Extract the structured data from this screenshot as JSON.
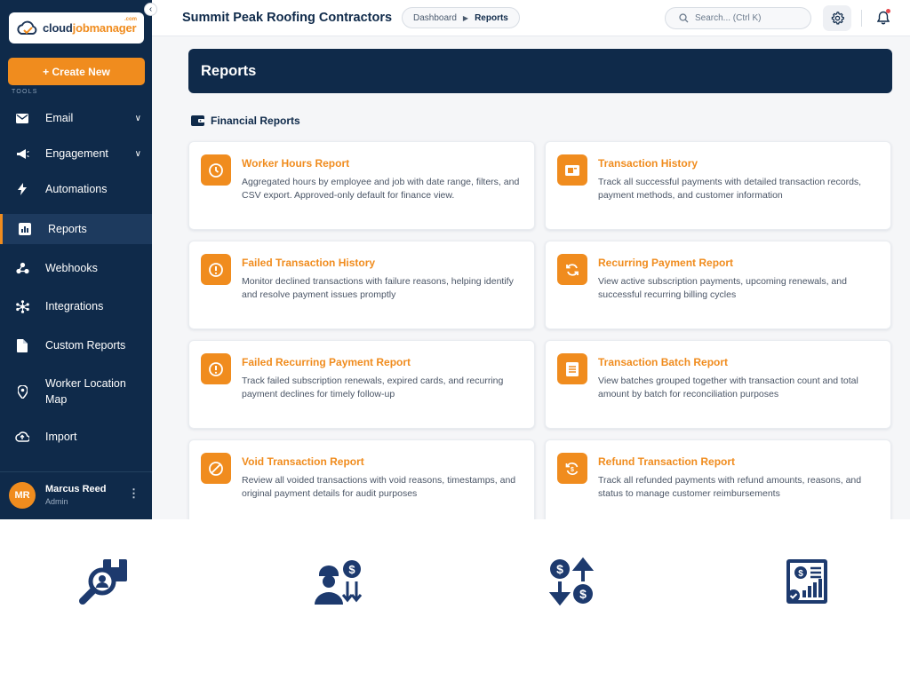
{
  "brand": {
    "name_part1": "cloud",
    "name_part2": "jobmanager",
    "suffix": ".com"
  },
  "sidebar": {
    "create_label": "+ Create New",
    "section_label": "TOOLS",
    "items": [
      {
        "label": "Email",
        "icon": "mail-icon",
        "has_chevron": true
      },
      {
        "label": "Engagement",
        "icon": "megaphone-icon",
        "has_chevron": true
      },
      {
        "label": "Automations",
        "icon": "bolt-icon",
        "has_chevron": false
      },
      {
        "label": "Reports",
        "icon": "chart-icon",
        "has_chevron": false,
        "active": true
      },
      {
        "label": "Webhooks",
        "icon": "webhook-icon",
        "has_chevron": false
      },
      {
        "label": "Integrations",
        "icon": "integrations-icon",
        "has_chevron": false
      },
      {
        "label": "Custom Reports",
        "icon": "file-icon",
        "has_chevron": false
      },
      {
        "label": "Worker Location Map",
        "icon": "location-pin-icon",
        "has_chevron": false
      },
      {
        "label": "Import",
        "icon": "cloud-upload-icon",
        "has_chevron": false
      }
    ],
    "user": {
      "initials": "MR",
      "name": "Marcus Reed",
      "role": "Admin"
    }
  },
  "topbar": {
    "company": "Summit Peak Roofing Contractors",
    "breadcrumb": [
      "Dashboard",
      "Reports"
    ],
    "search_placeholder": "Search... (Ctrl K)"
  },
  "page": {
    "title": "Reports",
    "section_title": "Financial Reports"
  },
  "reports": [
    {
      "title": "Worker Hours Report",
      "description": "Aggregated hours by employee and job with date range, filters, and CSV export. Approved-only default for finance view.",
      "icon": "clock-icon"
    },
    {
      "title": "Transaction History",
      "description": "Track all successful payments with detailed transaction records, payment methods, and customer information",
      "icon": "receipt-icon"
    },
    {
      "title": "Failed Transaction History",
      "description": "Monitor declined transactions with failure reasons, helping identify and resolve payment issues promptly",
      "icon": "alert-icon"
    },
    {
      "title": "Recurring Payment Report",
      "description": "View active subscription payments, upcoming renewals, and successful recurring billing cycles",
      "icon": "refresh-icon"
    },
    {
      "title": "Failed Recurring Payment Report",
      "description": "Track failed subscription renewals, expired cards, and recurring payment declines for timely follow-up",
      "icon": "alert-icon"
    },
    {
      "title": "Transaction Batch Report",
      "description": "View batches grouped together with transaction count and total amount by batch for reconciliation purposes",
      "icon": "document-icon"
    },
    {
      "title": "Void Transaction Report",
      "description": "Review all voided transactions with void reasons, timestamps, and original payment details for audit purposes",
      "icon": "ban-icon"
    },
    {
      "title": "Refund Transaction Report",
      "description": "Track all refunded payments with refund amounts, reasons, and status to manage customer reimbursements",
      "icon": "refund-icon"
    }
  ],
  "features": [
    {
      "icon": "inspection-magnifier-icon"
    },
    {
      "icon": "worker-payroll-icon"
    },
    {
      "icon": "cash-flow-icon"
    },
    {
      "icon": "financial-report-icon"
    }
  ],
  "colors": {
    "navy": "#0f2a4a",
    "accent": "#f08c1e"
  }
}
